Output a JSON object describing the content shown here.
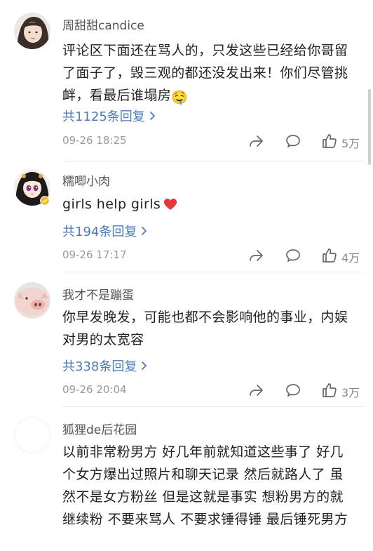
{
  "comments": [
    {
      "username": "周甜甜candice",
      "body": "评论区下面还在骂人的，只发这些已经给你哥留了面子了，毁三观的都还没发出来！你们尽管挑衅，看最后谁塌房",
      "emoji": "🤤",
      "replies": "共1125条回复",
      "time": "09-26 18:25",
      "likes": "5万"
    },
    {
      "username": "糯唧小肉",
      "body": "girls help girls",
      "emoji": "❤️",
      "replies": "共194条回复",
      "time": "09-26 17:17",
      "likes": "4万"
    },
    {
      "username": "我才不是蹦蛋",
      "body": "你早发晚发，可能也都不会影响他的事业，内娱对男的太宽容",
      "replies": "共338条回复",
      "time": "09-26 20:04",
      "likes": "3万"
    },
    {
      "username": "狐狸de后花园",
      "body": "以前非常粉男方 好几年前就知道这些事了 好几个女方爆出过照片和聊天记录 然后就路人了 虽然不是女方粉丝 但是这就是事实 想粉男方的就继续粉 不要来骂人 不要求锤得锤 最后锤死男方"
    }
  ],
  "icons": {
    "reply_chevron": "chevron-right-icon",
    "share": "share-icon",
    "comment": "comment-icon",
    "like": "thumbs-up-icon"
  },
  "colors": {
    "link": "#4a7cb7",
    "username": "#555555",
    "body": "#222222",
    "meta": "#999999",
    "divider": "#eaeaea"
  }
}
